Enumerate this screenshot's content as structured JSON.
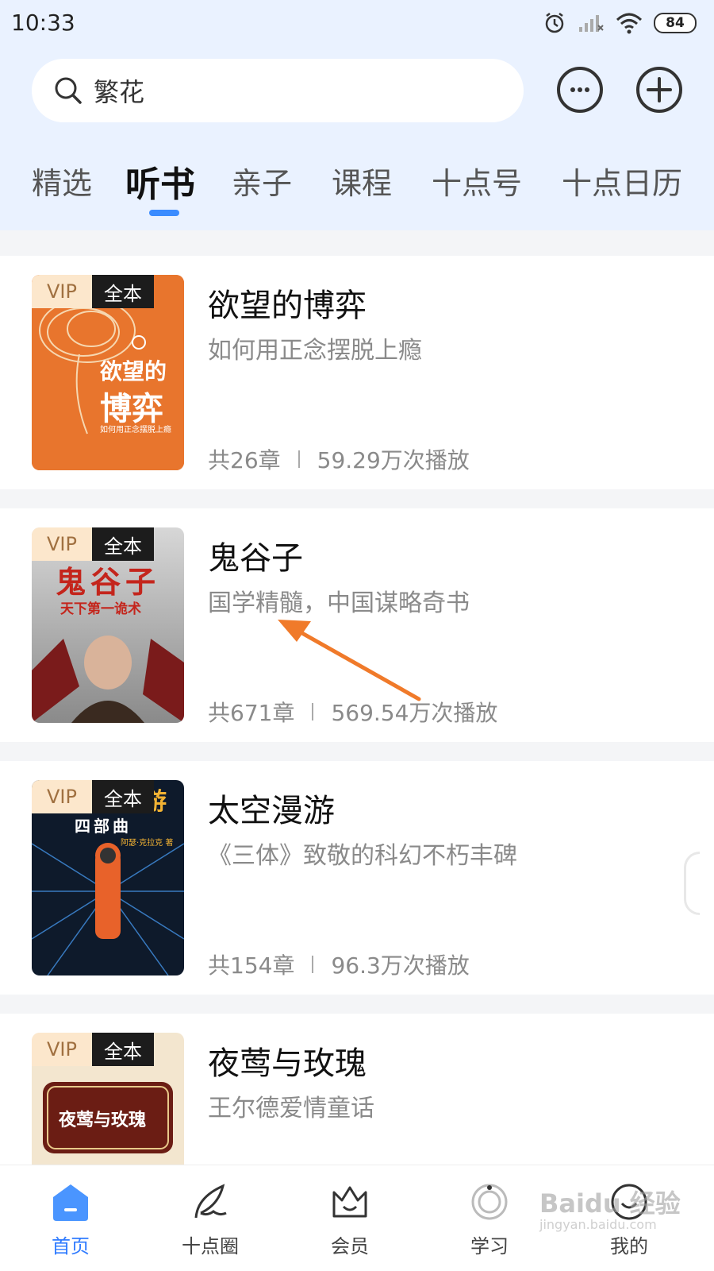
{
  "status_bar": {
    "time": "10:33",
    "battery": "84"
  },
  "search": {
    "value": "繁花"
  },
  "tabs": [
    {
      "label": "精选"
    },
    {
      "label": "听书",
      "active": true
    },
    {
      "label": "亲子"
    },
    {
      "label": "课程"
    },
    {
      "label": "十点号"
    },
    {
      "label": "十点日历"
    }
  ],
  "books": [
    {
      "title": "欲望的博弈",
      "subtitle": "如何用正念摆脱上瘾",
      "chapters": "共26章",
      "plays": "59.29万次播放",
      "badge_vip": "VIP",
      "badge_full": "全本",
      "cover_title_1": "欲望的",
      "cover_title_2": "博弈",
      "cover_caption": "如何用正念摆脱上瘾",
      "cover_color": "#e8752d"
    },
    {
      "title": "鬼谷子",
      "subtitle": "国学精髓，中国谋略奇书",
      "chapters": "共671章",
      "plays": "569.54万次播放",
      "badge_vip": "VIP",
      "badge_full": "全本",
      "cover_title_1": "鬼谷子",
      "cover_title_2": "天下第一诡术",
      "cover_color": "#bdbdbd"
    },
    {
      "title": "太空漫游",
      "subtitle": "《三体》致敬的科幻不朽丰碑",
      "chapters": "共154章",
      "plays": "96.3万次播放",
      "badge_vip": "VIP",
      "badge_full": "全本",
      "cover_title_1": "游",
      "cover_title_2": "四部曲",
      "cover_caption": "阿瑟·克拉克 著",
      "cover_color": "#0e1a2b"
    },
    {
      "title": "夜莺与玫瑰",
      "subtitle": "王尔德爱情童话",
      "badge_vip": "VIP",
      "badge_full": "全本",
      "cover_title_1": "夜莺与玫瑰",
      "cover_color": "#f3e6cf"
    }
  ],
  "bottom_nav": [
    {
      "label": "首页",
      "icon": "home-icon",
      "active": true
    },
    {
      "label": "十点圈",
      "icon": "feather-icon"
    },
    {
      "label": "会员",
      "icon": "crown-icon"
    },
    {
      "label": "学习",
      "icon": "study-icon"
    },
    {
      "label": "我的",
      "icon": "profile-icon"
    }
  ],
  "watermark": {
    "line1": "Baidu 经验",
    "line2": "jingyan.baidu.com"
  },
  "colors": {
    "accent": "#3b8cff",
    "header_bg": "#eaf2ff",
    "annotation_arrow": "#f07a2a"
  }
}
